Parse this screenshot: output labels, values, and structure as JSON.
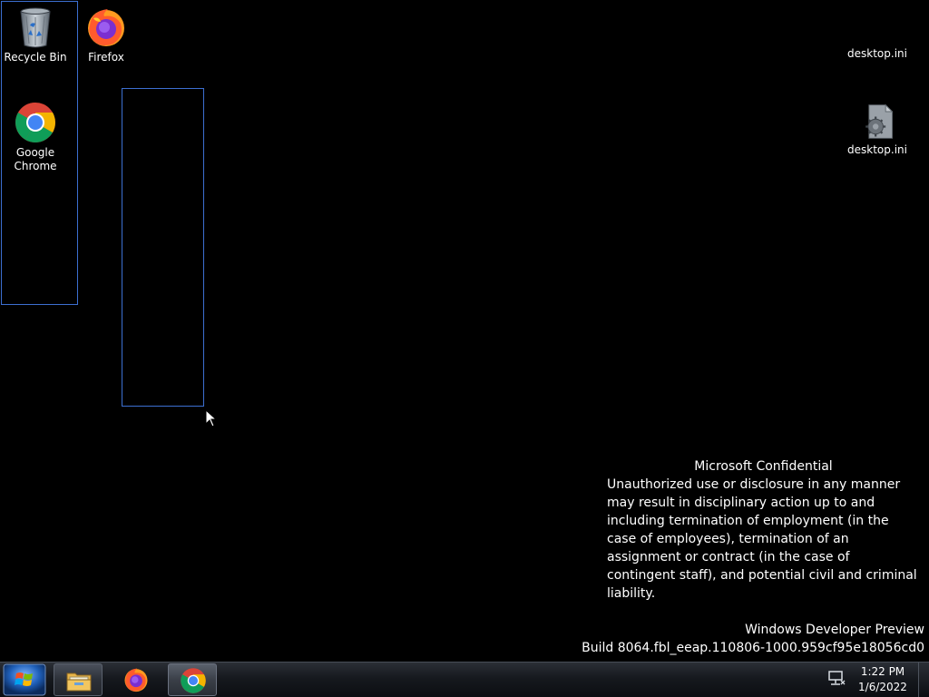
{
  "desktop": {
    "icons": [
      {
        "label": "Recycle Bin",
        "icon": "recycle-bin-icon"
      },
      {
        "label": "Firefox",
        "icon": "firefox-icon"
      },
      {
        "label": "Google Chrome",
        "icon": "chrome-icon"
      },
      {
        "label": "desktop.ini",
        "icon": "settings-file-icon"
      },
      {
        "label": "desktop.ini",
        "icon": "settings-file-icon"
      }
    ],
    "watermark": {
      "title": "Microsoft Confidential",
      "body": "Unauthorized use or disclosure in any manner may result in disciplinary action up to and including termination of employment (in the case of employees), termination of an assignment or contract (in the case of contingent staff), and potential civil and criminal liability.",
      "edition": "Windows Developer Preview",
      "build": "Build 8064.fbl_eeap.110806-1000.959cf95e18056cd0"
    }
  },
  "taskbar": {
    "start_icon": "windows-logo-icon",
    "buttons": [
      {
        "name": "file-explorer",
        "icon": "folder-icon",
        "state": "pinned"
      },
      {
        "name": "firefox",
        "icon": "firefox-icon",
        "state": "pinned"
      },
      {
        "name": "chrome",
        "icon": "chrome-icon",
        "state": "running"
      }
    ],
    "tray": {
      "network_icon": "network-icon",
      "time": "1:22 PM",
      "date": "1/6/2022"
    }
  },
  "colors": {
    "desktop_background": "#000000",
    "selection_border": "#3c6fd1",
    "text": "#ffffff"
  }
}
